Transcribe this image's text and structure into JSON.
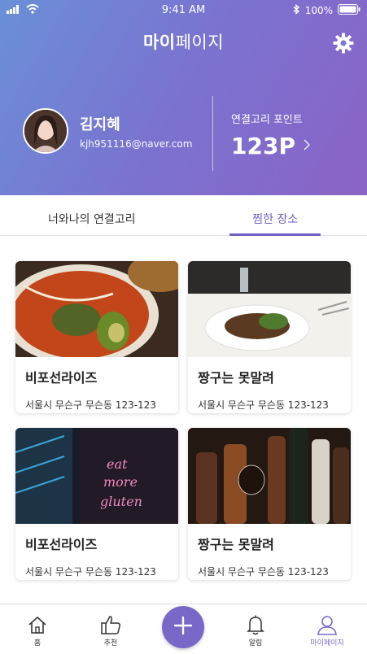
{
  "status_bar": {
    "time": "9:41 AM",
    "battery": "100%",
    "icons": [
      "signal-icon",
      "wifi-icon",
      "bluetooth-icon",
      "battery-icon"
    ]
  },
  "header": {
    "title_bold": "마이",
    "title_rest": "페이지",
    "settings_icon": "gear-icon"
  },
  "profile": {
    "name": "김지혜",
    "email": "kjh951116@naver.com"
  },
  "points": {
    "label": "연결고리 포인트",
    "value": "123P"
  },
  "tabs": [
    {
      "label": "너와나의 연결고리",
      "active": false
    },
    {
      "label": "찜한 장소",
      "active": true
    }
  ],
  "places": [
    {
      "name": "비포선라이즈",
      "address": "서울시 무슨구 무슨동 123-123",
      "image": "curry-dish"
    },
    {
      "name": "짱구는 못말려",
      "address": "서울시 무슨구 무슨동 123-123",
      "image": "plated-meal"
    },
    {
      "name": "비포선라이즈",
      "address": "서울시 무슨구 무슨동 123-123",
      "image": "neon-sign"
    },
    {
      "name": "짱구는 못말려",
      "address": "서울시 무슨구 무슨동 123-123",
      "image": "bottles"
    }
  ],
  "bottom_nav": [
    {
      "label": "홈",
      "icon": "home-icon"
    },
    {
      "label": "추천",
      "icon": "thumbs-up-icon"
    },
    {
      "label": "",
      "icon": "plus-icon"
    },
    {
      "label": "알림",
      "icon": "bell-icon"
    },
    {
      "label": "마이페이지",
      "icon": "user-icon",
      "active": true
    }
  ],
  "colors": {
    "accent": "#6f60c5",
    "gradient_start": "#6a8fd8",
    "gradient_end": "#8a63c6"
  }
}
